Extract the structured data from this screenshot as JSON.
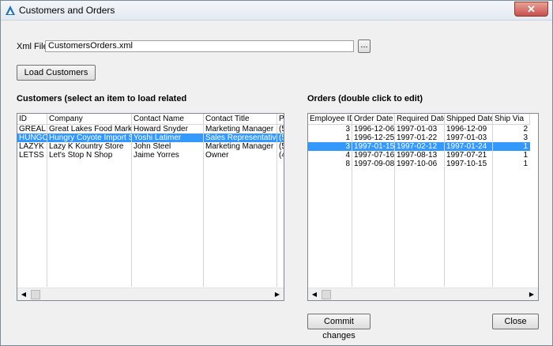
{
  "window": {
    "title": "Customers and Orders",
    "close_glyph": "✕"
  },
  "xml_file": {
    "label": "Xml File:",
    "value": "CustomersOrders.xml",
    "browse_label": "..."
  },
  "load_button": "Load Customers",
  "customers": {
    "title": "Customers (select an item to load related",
    "columns": [
      "ID",
      "Company",
      "Contact Name",
      "Contact Title",
      "Ph"
    ],
    "rows": [
      [
        "GREAL",
        "Great Lakes Food Market",
        "Howard Snyder",
        "Marketing Manager",
        "(5"
      ],
      [
        "HUNGC",
        "Hungry Coyote Import Store",
        "Yoshi Latimer",
        "Sales Representative",
        "(5"
      ],
      [
        "LAZYK",
        "Lazy K Kountry Store",
        "John Steel",
        "Marketing Manager",
        "(5"
      ],
      [
        "LETSS",
        "Let's Stop N Shop",
        "Jaime Yorres",
        "Owner",
        "(4"
      ]
    ],
    "selected_index": 1
  },
  "orders": {
    "title": "Orders (double click to edit)",
    "columns": [
      "Employee ID",
      "Order Date",
      "Required Date",
      "Shipped Date",
      "Ship Via"
    ],
    "rows": [
      [
        "3",
        "1996-12-06",
        "1997-01-03",
        "1996-12-09",
        "2"
      ],
      [
        "1",
        "1996-12-25",
        "1997-01-22",
        "1997-01-03",
        "3"
      ],
      [
        "3",
        "1997-01-15",
        "1997-02-12",
        "1997-01-24",
        "1"
      ],
      [
        "4",
        "1997-07-16",
        "1997-08-13",
        "1997-07-21",
        "1"
      ],
      [
        "8",
        "1997-09-08",
        "1997-10-06",
        "1997-10-15",
        "1"
      ]
    ],
    "selected_index": 2
  },
  "commit_button": "Commit changes",
  "close_button": "Close",
  "colors": {
    "selection": "#3399ff",
    "app_icon": "#1e73be"
  },
  "icons": {
    "app": "app-logo-icon",
    "scroll_left": "scroll-left-icon",
    "scroll_right": "scroll-right-icon"
  }
}
